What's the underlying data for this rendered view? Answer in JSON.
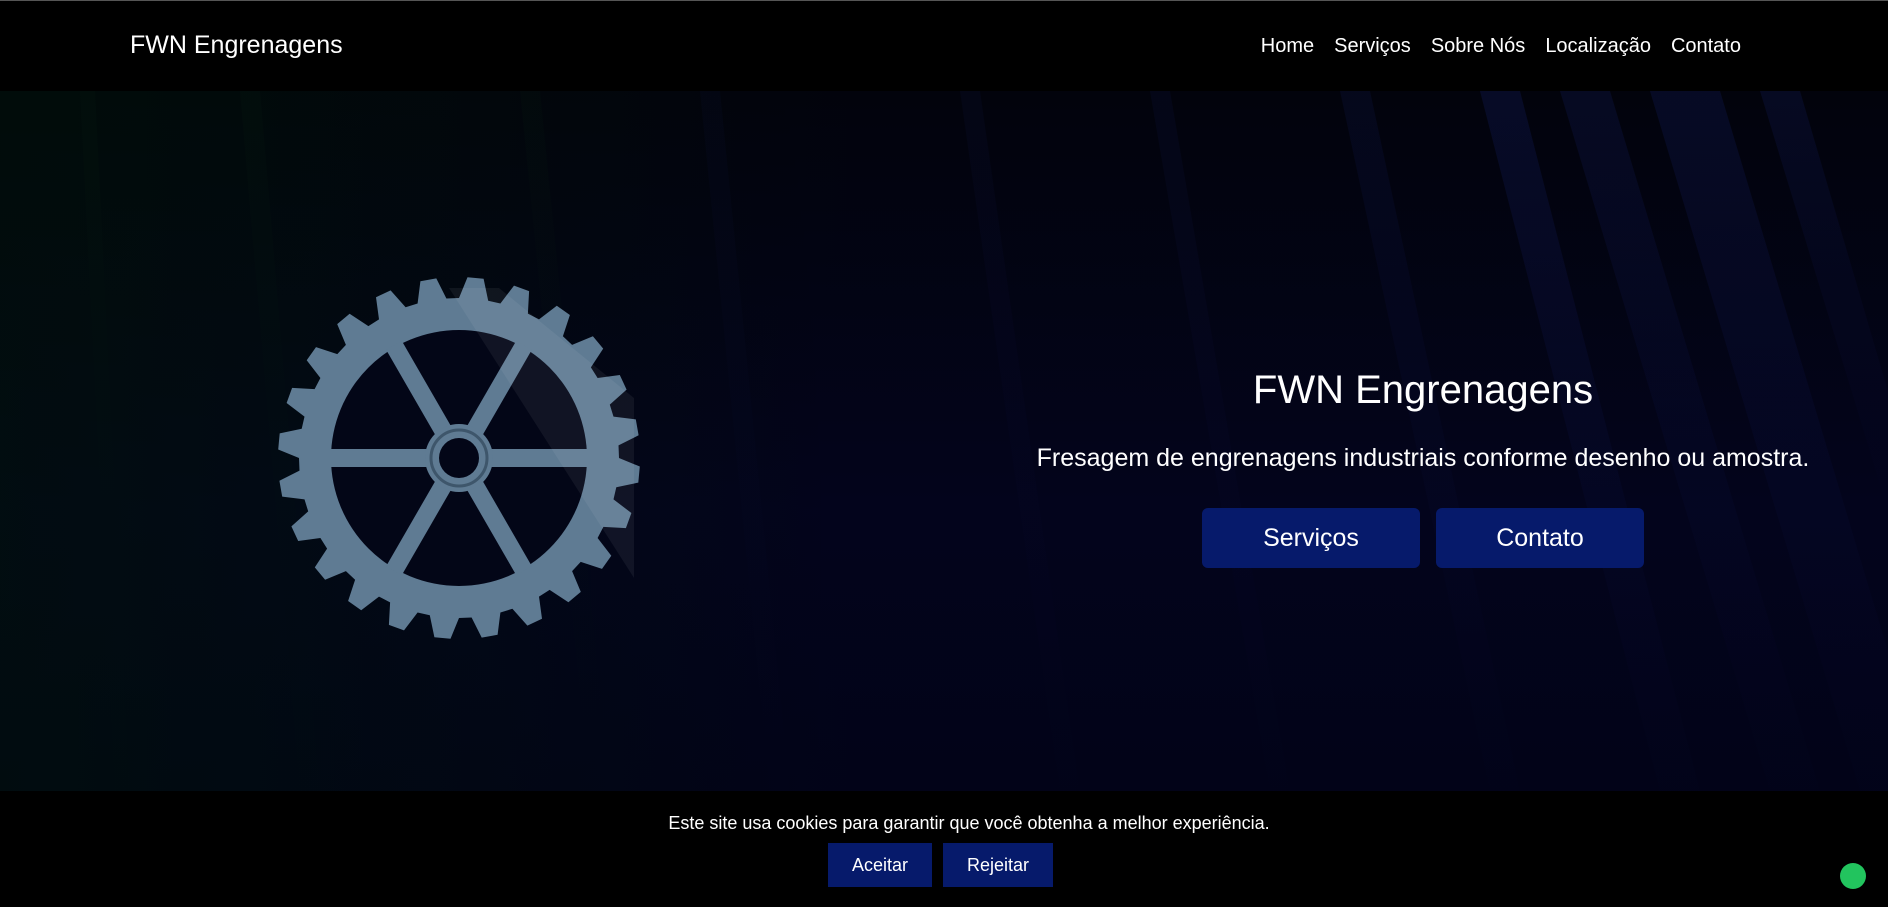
{
  "header": {
    "brand": "FWN Engrenagens",
    "nav": [
      {
        "label": "Home"
      },
      {
        "label": "Serviços"
      },
      {
        "label": "Sobre Nós"
      },
      {
        "label": "Localização"
      },
      {
        "label": "Contato"
      }
    ]
  },
  "hero": {
    "title": "FWN Engrenagens",
    "subtitle": "Fresagem de engrenagens industriais conforme desenho ou amostra.",
    "buttons": {
      "servicos": "Serviços",
      "contato": "Contato"
    },
    "gear_icon": "gear-icon"
  },
  "cookie_banner": {
    "message": "Este site usa cookies para garantir que você obtenha a melhor experiência.",
    "accept_label": "Aceitar",
    "reject_label": "Rejeitar"
  },
  "colors": {
    "header_bg": "#000000",
    "button_bg": "#061a6b",
    "gear": "#5f7b93",
    "status_dot": "#22c45e"
  }
}
